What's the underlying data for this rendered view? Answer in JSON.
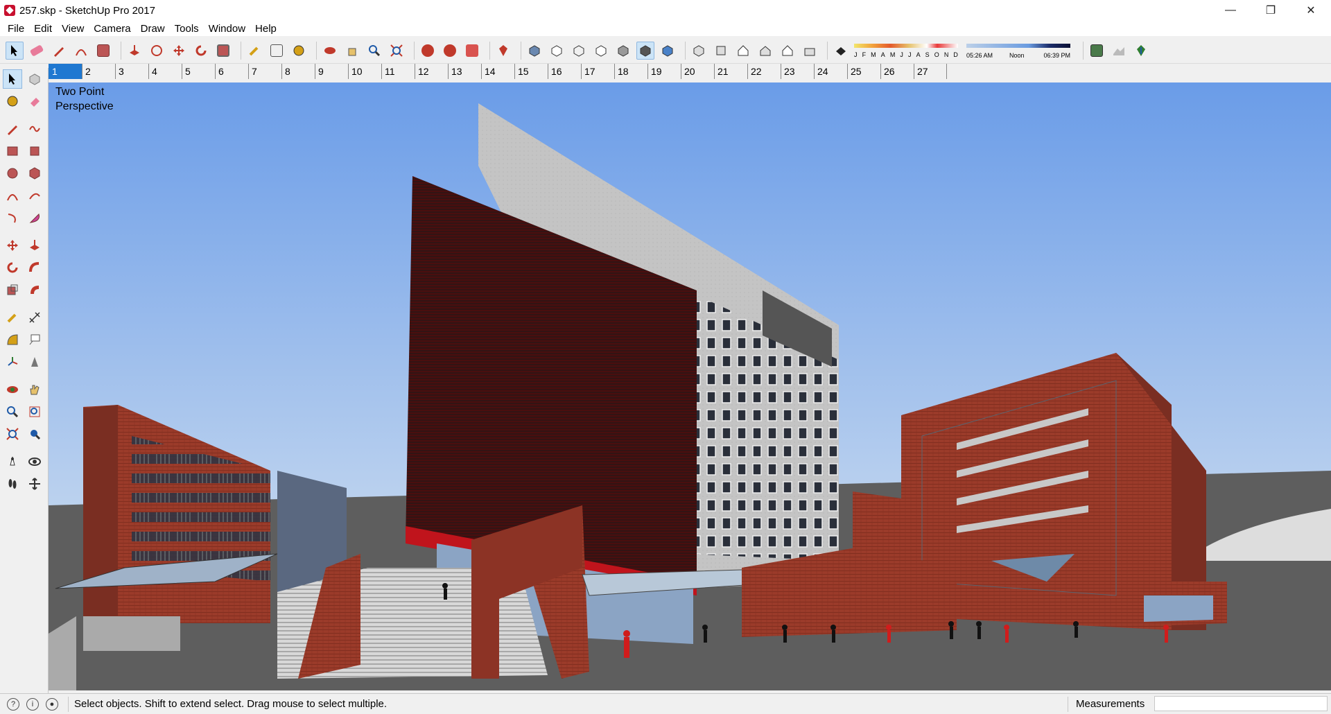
{
  "window": {
    "title": "257.skp - SketchUp Pro 2017",
    "minimize": "—",
    "restore": "❐",
    "close": "✕"
  },
  "menu": [
    "File",
    "Edit",
    "View",
    "Camera",
    "Draw",
    "Tools",
    "Window",
    "Help"
  ],
  "toolbar": {
    "months": [
      "J",
      "F",
      "M",
      "A",
      "M",
      "J",
      "J",
      "A",
      "S",
      "O",
      "N",
      "D"
    ],
    "sunrise": "05:26 AM",
    "noon": "Noon",
    "sunset": "06:39 PM"
  },
  "scenes": [
    "1",
    "2",
    "3",
    "4",
    "5",
    "6",
    "7",
    "8",
    "9",
    "10",
    "11",
    "12",
    "13",
    "14",
    "15",
    "16",
    "17",
    "18",
    "19",
    "20",
    "21",
    "22",
    "23",
    "24",
    "25",
    "26",
    "27"
  ],
  "active_scene": "1",
  "viewport": {
    "label_line1": "Two Point",
    "label_line2": "Perspective"
  },
  "status": {
    "message": "Select objects. Shift to extend select. Drag mouse to select multiple.",
    "measurements_label": "Measurements",
    "measurements_value": ""
  },
  "colors": {
    "sky_top": "#6a9ce8",
    "sky_bottom": "#e6eef7",
    "brick": "#9b3b2a",
    "concrete": "#bfbfbf",
    "ground": "#5a5a5a",
    "selection": "#1f78d1"
  }
}
